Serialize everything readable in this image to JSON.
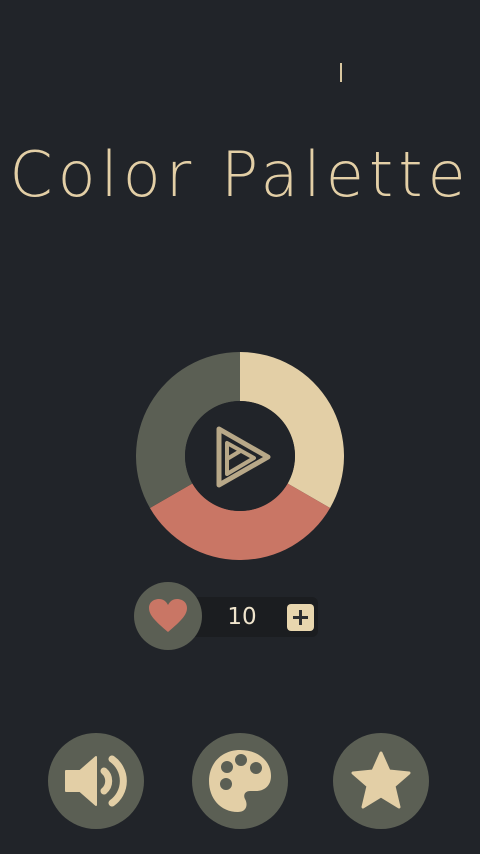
{
  "app": {
    "title": "Color Palette"
  },
  "colors": {
    "background": "#212429",
    "cream": "#e3cfa6",
    "salmon": "#c97665",
    "olive": "#5b5f54"
  },
  "wheel": {
    "segments": [
      {
        "color": "cream",
        "fraction": 0.333
      },
      {
        "color": "salmon",
        "fraction": 0.333
      },
      {
        "color": "olive",
        "fraction": 0.334
      }
    ],
    "center_icon": "play-icon"
  },
  "lives": {
    "icon": "heart-icon",
    "count": "10",
    "add_icon": "plus-icon"
  },
  "bottom_bar": {
    "buttons": [
      {
        "name": "sound",
        "icon": "speaker-icon"
      },
      {
        "name": "theme",
        "icon": "palette-icon"
      },
      {
        "name": "rate",
        "icon": "star-icon"
      }
    ]
  }
}
